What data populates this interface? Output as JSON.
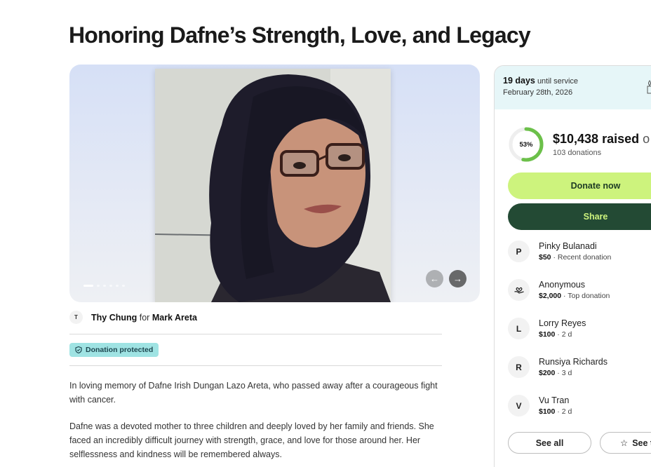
{
  "page": {
    "title": "Honoring Dafne’s Strength, Love, and Legacy"
  },
  "organizer": {
    "avatar_initial": "T",
    "name": "Thy Chung",
    "connector": "for",
    "beneficiary": "Mark Areta"
  },
  "badge": {
    "label": "Donation protected"
  },
  "story": {
    "paragraphs": [
      "In loving memory of Dafne Irish Dungan Lazo Areta, who passed away after a courageous fight with cancer.",
      "Dafne was a devoted mother to three children and deeply loved by her family and friends. She faced an incredibly difficult journey with strength, grace, and love for those around her. Her selflessness and kindness will be remembered always."
    ]
  },
  "service": {
    "days": "19 days",
    "until_label": "until service",
    "date": "February 28th, 2026"
  },
  "fundraiser": {
    "percent_label": "53%",
    "progress_fraction": 0.53,
    "raised": "$10,438 raised",
    "raised_suffix": "o",
    "donations_count": "103 donations"
  },
  "actions": {
    "donate": "Donate now",
    "share": "Share",
    "see_all": "See all",
    "see_top": "See t"
  },
  "donors": [
    {
      "initial": "P",
      "name": "Pinky Bulanadi",
      "amount": "$50",
      "detail": " · Recent donation"
    },
    {
      "initial": "",
      "name": "Anonymous",
      "amount": "$2,000",
      "detail": " · Top donation"
    },
    {
      "initial": "L",
      "name": "Lorry Reyes",
      "amount": "$100",
      "detail": " · 2 d"
    },
    {
      "initial": "R",
      "name": "Runsiya Richards",
      "amount": "$200",
      "detail": " · 3 d"
    },
    {
      "initial": "V",
      "name": "Vu Tran",
      "amount": "$100",
      "detail": " · 2 d"
    }
  ],
  "colors": {
    "accent_green": "#cdf37d",
    "dark_green": "#234a34",
    "progress_green": "#6cc04a",
    "badge_teal": "#9fe3e3",
    "service_bg": "#e6f6f8"
  }
}
